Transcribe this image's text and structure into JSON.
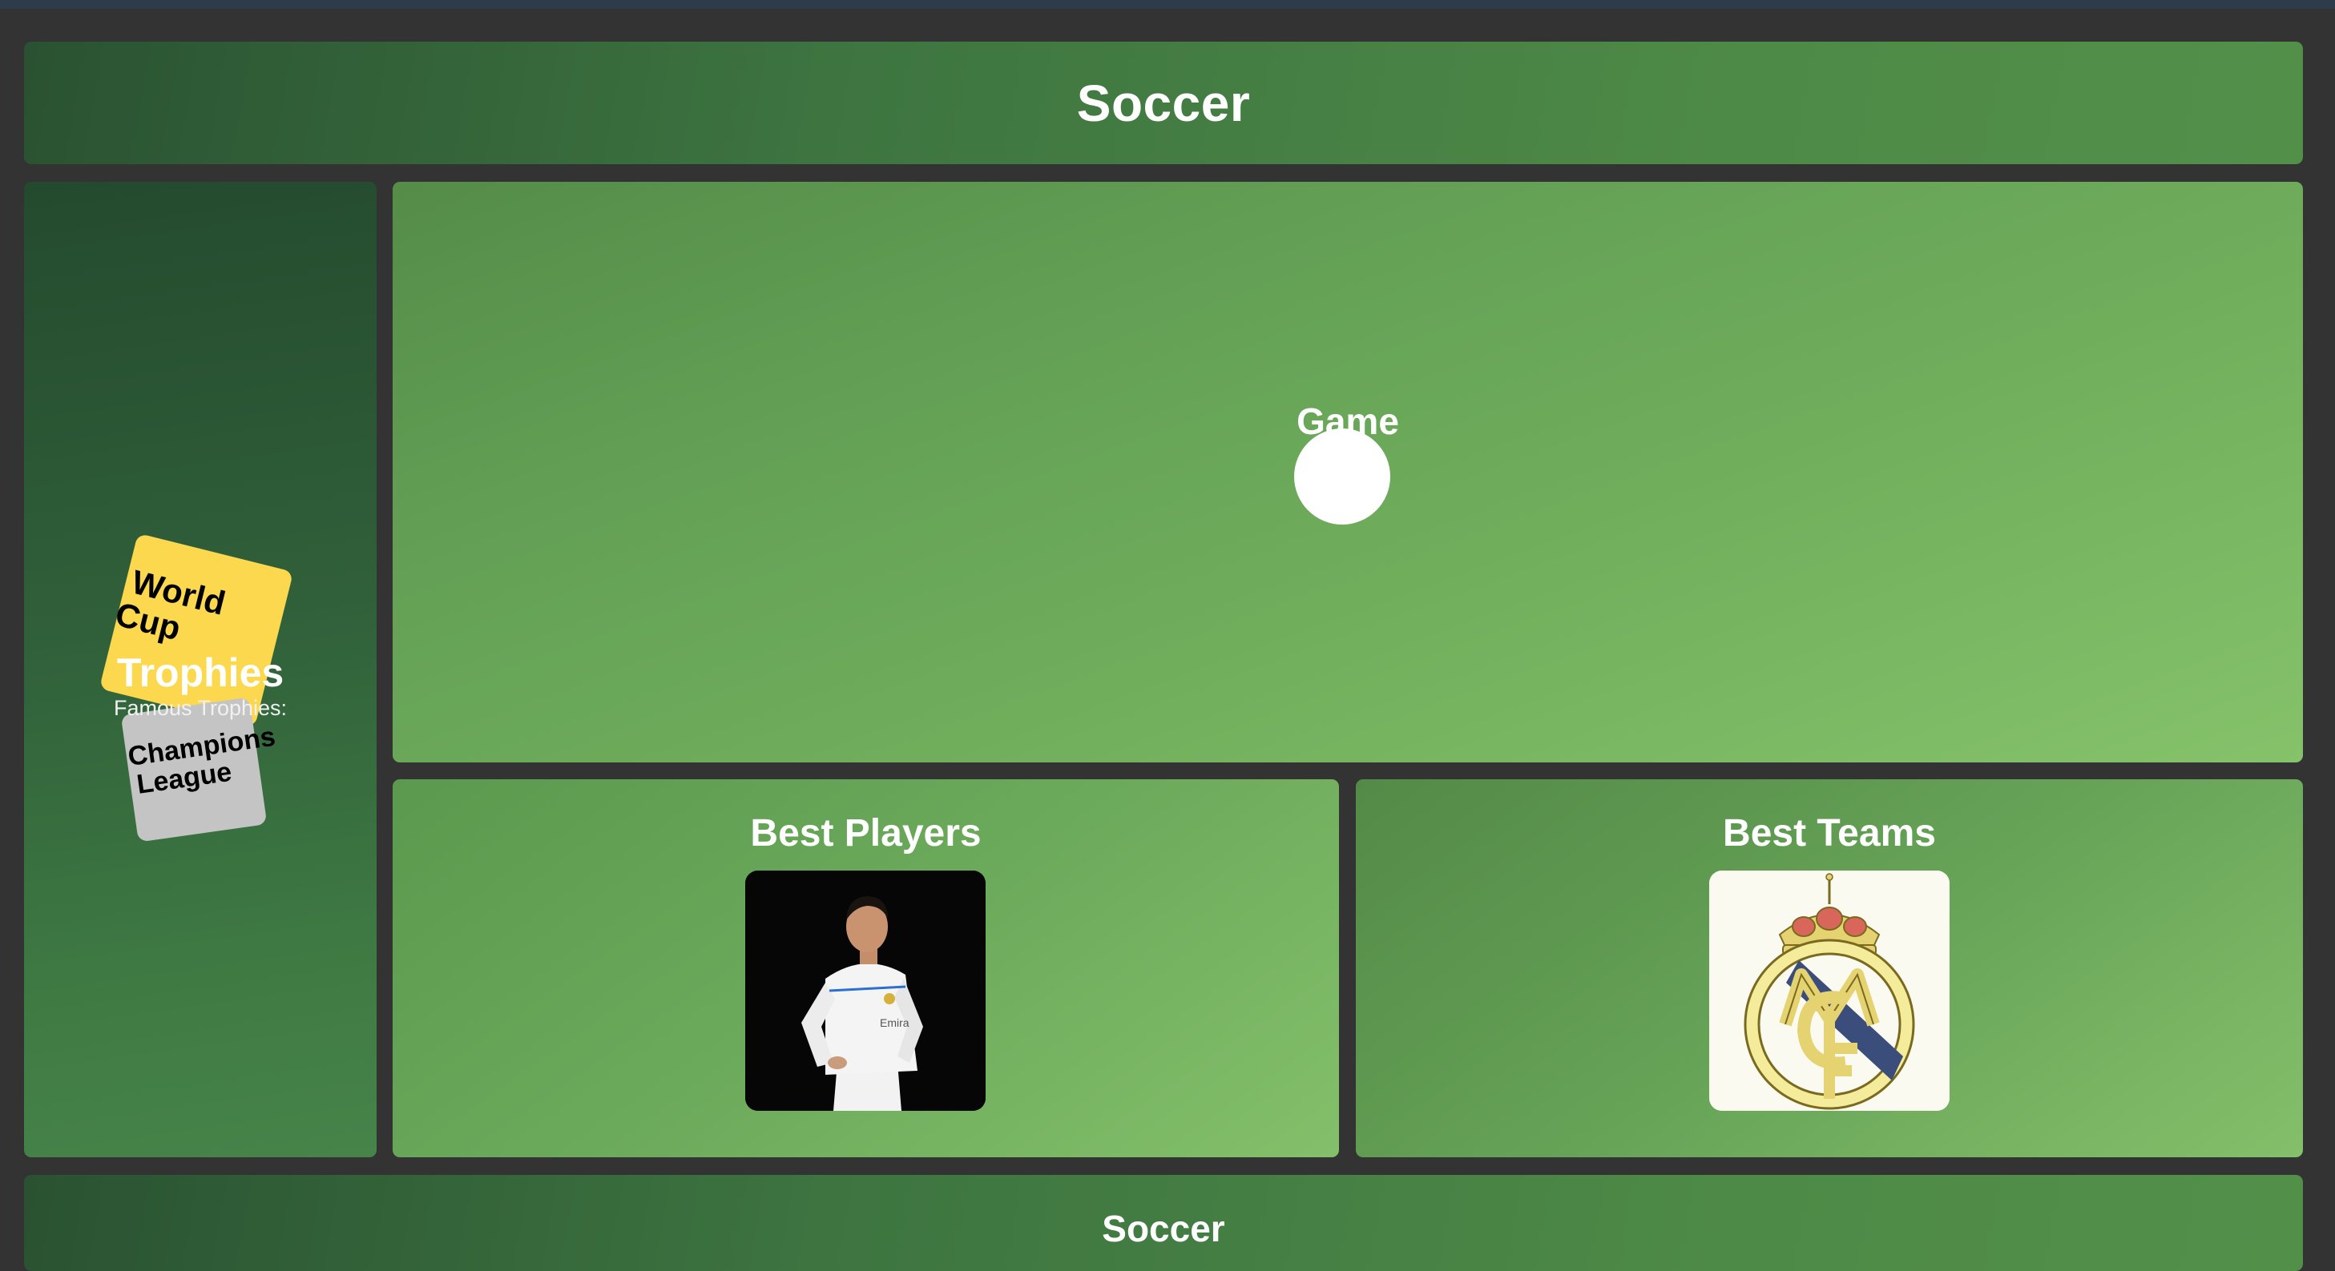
{
  "header": {
    "title": "Soccer"
  },
  "sidebar": {
    "title": "Trophies",
    "subtitle": "Famous Trophies:",
    "trophies": [
      {
        "label_line1": "World",
        "label_line2": "Cup",
        "color": "#fcd84e"
      },
      {
        "label_line1": "Champions",
        "label_line2": "League",
        "color": "#c4c4c4"
      }
    ]
  },
  "game": {
    "title": "Game"
  },
  "players": {
    "title": "Best Players",
    "image_alt": "Player photo"
  },
  "teams": {
    "title": "Best Teams",
    "image_alt": "Team crest"
  },
  "footer": {
    "title": "Soccer"
  },
  "colors": {
    "background": "#333333",
    "panel_green_dark": "#2a5232",
    "panel_green_light": "#85c26a",
    "ball": "#ffffff"
  }
}
